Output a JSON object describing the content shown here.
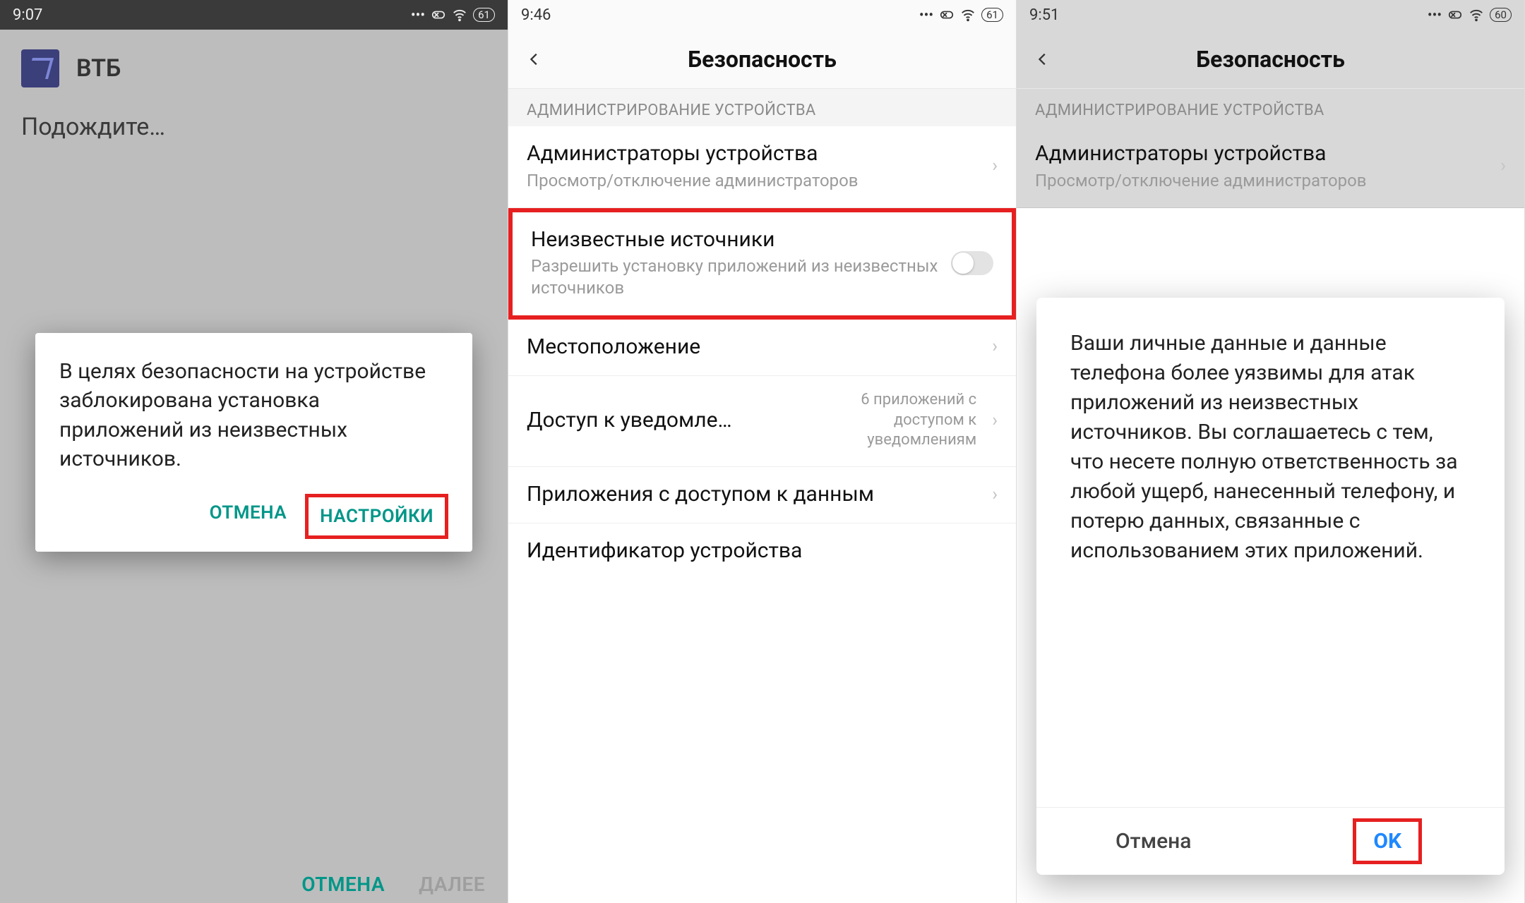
{
  "screen1": {
    "status_time": "9:07",
    "status_battery": "61",
    "app_name": "ВТБ",
    "waiting": "Подождите…",
    "dialog_text": "В целях безопасности на устройстве заблокирована установка приложений из неизвестных источников.",
    "cancel": "ОТМЕНА",
    "settings": "НАСТРОЙКИ",
    "bottom_cancel": "ОТМЕНА",
    "bottom_next": "ДАЛЕЕ"
  },
  "screen2": {
    "status_time": "9:46",
    "status_battery": "61",
    "title": "Безопасность",
    "section": "АДМИНИСТРИРОВАНИЕ УСТРОЙСТВА",
    "admins_title": "Администраторы устройства",
    "admins_sub": "Просмотр/отключение администраторов",
    "unknown_title": "Неизвестные источники",
    "unknown_sub": "Разрешить установку приложений из неизвестных источников",
    "location_title": "Местоположение",
    "notif_title": "Доступ к уведомле…",
    "notif_right": "6 приложений с доступом к уведомлениям",
    "data_access_title": "Приложения с доступом к данным",
    "device_id_title": "Идентификатор устройства"
  },
  "screen3": {
    "status_time": "9:51",
    "status_battery": "60",
    "title": "Безопасность",
    "section": "АДМИНИСТРИРОВАНИЕ УСТРОЙСТВА",
    "admins_title": "Администраторы устройства",
    "admins_sub": "Просмотр/отключение администраторов",
    "dialog_text": "Ваши личные данные и данные телефона более уязвимы для атак приложений из неизвестных источников. Вы соглашаетесь с тем, что несете полную ответственность за любой ущерб, нанесенный телефону, и потерю данных, связанные с использованием этих приложений.",
    "dialog_cancel": "Отмена",
    "dialog_ok": "OK"
  }
}
